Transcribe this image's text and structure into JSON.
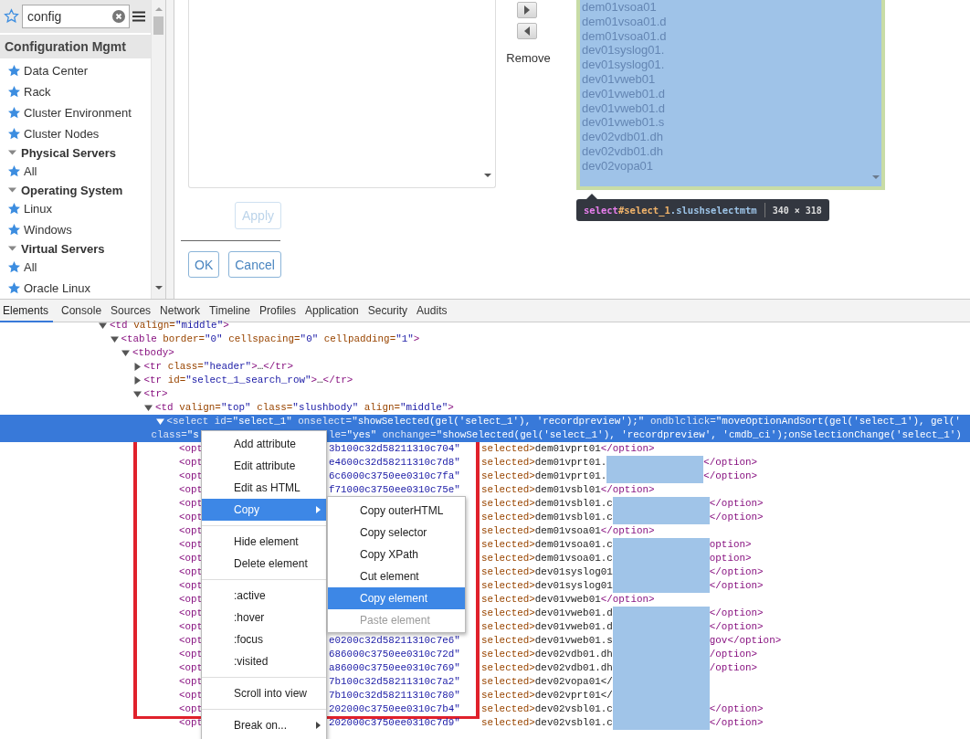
{
  "sidebar": {
    "search": {
      "value": "config"
    },
    "section": "Configuration Mgmt",
    "items": [
      {
        "kind": "item",
        "label": "Data Center"
      },
      {
        "kind": "item",
        "label": "Rack"
      },
      {
        "kind": "item",
        "label": "Cluster Environment"
      },
      {
        "kind": "item",
        "label": "Cluster Nodes"
      },
      {
        "kind": "group",
        "label": "Physical Servers",
        "expanded": true
      },
      {
        "kind": "item",
        "label": "All"
      },
      {
        "kind": "group",
        "label": "Operating System",
        "expanded": true
      },
      {
        "kind": "item",
        "label": "Linux"
      },
      {
        "kind": "item",
        "label": "Windows"
      },
      {
        "kind": "group",
        "label": "Virtual Servers",
        "expanded": true
      },
      {
        "kind": "item",
        "label": "All"
      },
      {
        "kind": "item",
        "label": "Oracle Linux"
      }
    ]
  },
  "form": {
    "apply": {
      "label": "Apply",
      "disabled": true
    },
    "ok": {
      "label": "OK",
      "disabled": false
    },
    "cancel": {
      "label": "Cancel",
      "disabled": false
    },
    "remove_label": "Remove",
    "selected_list": {
      "highlighted": true,
      "items": [
        "dem01vsoa01",
        "dem01vsoa01.d",
        "dem01vsoa01.d",
        "dev01syslog01.",
        "dev01syslog01.",
        "dev01vweb01",
        "dev01vweb01.d",
        "dev01vweb01.d",
        "dev01vweb01.s",
        "dev02vdb01.dh",
        "dev02vdb01.dh",
        "dev02vopa01"
      ]
    },
    "tooltip": {
      "tag": "select",
      "id": "#select_1",
      "class": ".slushselectmtm",
      "size": "340 × 318"
    }
  },
  "devtools": {
    "tabs": [
      {
        "label": "Elements",
        "selected": true
      },
      {
        "label": "Console",
        "selected": false
      },
      {
        "label": "Sources",
        "selected": false
      },
      {
        "label": "Network",
        "selected": false
      },
      {
        "label": "Timeline",
        "selected": false
      },
      {
        "label": "Profiles",
        "selected": false
      },
      {
        "label": "Application",
        "selected": false
      },
      {
        "label": "Security",
        "selected": false
      },
      {
        "label": "Audits",
        "selected": false
      }
    ],
    "tree": {
      "kind": "element",
      "selected": false,
      "expanded": true,
      "tokens": [
        {
          "kind": "tag",
          "text": "<td"
        },
        {
          "kind": "attr",
          "text": " valign="
        },
        {
          "kind": "val",
          "text": "\"middle\""
        },
        {
          "kind": "tag",
          "text": ">"
        }
      ],
      "children": [
        {
          "kind": "element",
          "selected": false,
          "expanded": true,
          "tokens": [
            {
              "kind": "tag",
              "text": "<table"
            },
            {
              "kind": "attr",
              "text": " border="
            },
            {
              "kind": "val",
              "text": "\"0\""
            },
            {
              "kind": "attr",
              "text": " cellspacing="
            },
            {
              "kind": "val",
              "text": "\"0\""
            },
            {
              "kind": "attr",
              "text": " cellpadding="
            },
            {
              "kind": "val",
              "text": "\"1\""
            },
            {
              "kind": "tag",
              "text": ">"
            }
          ],
          "children": [
            {
              "kind": "element",
              "selected": false,
              "expanded": true,
              "tokens": [
                {
                  "kind": "tag",
                  "text": "<tbody>"
                }
              ],
              "children": [
                {
                  "kind": "element",
                  "selected": false,
                  "expanded": false,
                  "tokens": [
                    {
                      "kind": "tag",
                      "text": "<tr"
                    },
                    {
                      "kind": "attr",
                      "text": " class="
                    },
                    {
                      "kind": "val",
                      "text": "\"header\""
                    },
                    {
                      "kind": "tag",
                      "text": ">"
                    },
                    {
                      "kind": "text",
                      "text": "…"
                    },
                    {
                      "kind": "tag",
                      "text": "</tr>"
                    }
                  ]
                },
                {
                  "kind": "element",
                  "selected": false,
                  "expanded": false,
                  "tokens": [
                    {
                      "kind": "tag",
                      "text": "<tr"
                    },
                    {
                      "kind": "attr",
                      "text": " id="
                    },
                    {
                      "kind": "val",
                      "text": "\"select_1_search_row\""
                    },
                    {
                      "kind": "tag",
                      "text": ">"
                    },
                    {
                      "kind": "text",
                      "text": "…"
                    },
                    {
                      "kind": "tag",
                      "text": "</tr>"
                    }
                  ]
                },
                {
                  "kind": "element",
                  "selected": false,
                  "expanded": true,
                  "tokens": [
                    {
                      "kind": "tag",
                      "text": "<tr>"
                    }
                  ],
                  "children": [
                    {
                      "kind": "element",
                      "selected": false,
                      "expanded": true,
                      "tokens": [
                        {
                          "kind": "tag",
                          "text": "<td"
                        },
                        {
                          "kind": "attr",
                          "text": " valign="
                        },
                        {
                          "kind": "val",
                          "text": "\"top\""
                        },
                        {
                          "kind": "attr",
                          "text": " class="
                        },
                        {
                          "kind": "val",
                          "text": "\"slushbody\""
                        },
                        {
                          "kind": "attr",
                          "text": " align="
                        },
                        {
                          "kind": "val",
                          "text": "\"middle\""
                        },
                        {
                          "kind": "tag",
                          "text": ">"
                        }
                      ],
                      "children": [
                        {
                          "kind": "element",
                          "selected": true,
                          "expanded": true,
                          "tokens": [
                            {
                              "kind": "tag",
                              "text": "<select"
                            },
                            {
                              "kind": "attr",
                              "text": " id="
                            },
                            {
                              "kind": "val",
                              "text": "\"select_1\""
                            },
                            {
                              "kind": "attr",
                              "text": " onselect="
                            },
                            {
                              "kind": "val",
                              "text": "\"showSelected(gel('select_1'), 'recordpreview');\""
                            },
                            {
                              "kind": "attr",
                              "text": " ondblclick="
                            },
                            {
                              "kind": "val",
                              "text": "\"moveOptionAndSort(gel('select_1'), gel('"
                            }
                          ],
                          "cont": [
                            {
                              "kind": "attr",
                              "text": "class="
                            },
                            {
                              "kind": "val",
                              "text": "\"s"
                            }
                          ],
                          "cont_after": [
                            {
                              "kind": "attr",
                              "text": "le="
                            },
                            {
                              "kind": "val",
                              "text": "\"yes\""
                            },
                            {
                              "kind": "attr",
                              "text": " onchange="
                            },
                            {
                              "kind": "val",
                              "text": "\"showSelected(gel('select_1'), 'recordpreview', 'cmdb_ci');onSelectionChange('select_1')"
                            }
                          ],
                          "children": [
                            {
                              "kind": "option",
                              "selected": false,
                              "open": "<opt",
                              "hash": "3b100c32d58211310c704\"",
                              "attr": "selected>",
                              "text": "dem01vprt01",
                              "close": "</option>",
                              "redacted": false
                            },
                            {
                              "kind": "option",
                              "selected": false,
                              "open": "<opt",
                              "hash": "e4600c32d58211310c7d8\"",
                              "attr": "selected>",
                              "text": "dem01vprt01.",
                              "close": "</option>",
                              "redacted": true
                            },
                            {
                              "kind": "option",
                              "selected": false,
                              "open": "<opt",
                              "hash": "6c6000c3750ee0310c7fa\"",
                              "attr": "selected>",
                              "text": "dem01vprt01.",
                              "close": "</option>",
                              "redacted": true
                            },
                            {
                              "kind": "option",
                              "selected": false,
                              "open": "<opt",
                              "hash": "f71000c3750ee0310c75e\"",
                              "attr": "selected>",
                              "text": "dem01vsbl01",
                              "close": "</option>",
                              "redacted": false
                            },
                            {
                              "kind": "option",
                              "selected": false,
                              "open": "<opt",
                              "attr": "selected>",
                              "text": "dem01vsbl01.c",
                              "close": "</option>",
                              "redacted": true
                            },
                            {
                              "kind": "option",
                              "selected": false,
                              "open": "<opt",
                              "attr": "selected>",
                              "text": "dem01vsbl01.c",
                              "close": "</option>",
                              "redacted": true
                            },
                            {
                              "kind": "option",
                              "selected": false,
                              "open": "<opt",
                              "attr": "selected>",
                              "text": "dem01vsoa01",
                              "close": "</option>",
                              "redacted": false
                            },
                            {
                              "kind": "option",
                              "selected": false,
                              "open": "<opt",
                              "attr": "selected>",
                              "text": "dem01vsoa01.c",
                              "close": "option>",
                              "redacted": true
                            },
                            {
                              "kind": "option",
                              "selected": false,
                              "open": "<opt",
                              "attr": "selected>",
                              "text": "dem01vsoa01.c",
                              "close": "option>",
                              "redacted": true
                            },
                            {
                              "kind": "option",
                              "selected": false,
                              "open": "<opt",
                              "attr": "selected>",
                              "text": "dev01syslog01",
                              "close": "</option>",
                              "redacted": true
                            },
                            {
                              "kind": "option",
                              "selected": false,
                              "open": "<opt",
                              "attr": "selected>",
                              "text": "dev01syslog01",
                              "close": "</option>",
                              "redacted": true
                            },
                            {
                              "kind": "option",
                              "selected": false,
                              "open": "<opt",
                              "attr": "selected>",
                              "text": "dev01vweb01",
                              "close": "</option>",
                              "redacted": false
                            },
                            {
                              "kind": "option",
                              "selected": false,
                              "open": "<opt",
                              "attr": "selected>",
                              "text": "dev01vweb01.d",
                              "close": "</option>",
                              "redacted": true
                            },
                            {
                              "kind": "option",
                              "selected": false,
                              "open": "<opt",
                              "attr": "selected>",
                              "text": "dev01vweb01.d",
                              "close": "</option>",
                              "redacted": true
                            },
                            {
                              "kind": "option",
                              "selected": false,
                              "open": "<opt",
                              "hash": "e0200c32d58211310c7e6\"",
                              "attr": "selected>",
                              "text": "dev01vweb01.s",
                              "close": "gov</option>",
                              "redacted": true
                            },
                            {
                              "kind": "option",
                              "selected": false,
                              "open": "<opt",
                              "hash": "686000c3750ee0310c72d\"",
                              "attr": "selected>",
                              "text": "dev02vdb01.dh",
                              "close": "/option>",
                              "redacted": true
                            },
                            {
                              "kind": "option",
                              "selected": false,
                              "open": "<opt",
                              "hash": "a86000c3750ee0310c769\"",
                              "attr": "selected>",
                              "text": "dev02vdb01.dh",
                              "close": "/option>",
                              "redacted": true
                            },
                            {
                              "kind": "option",
                              "selected": false,
                              "open": "<opt",
                              "hash": "7b100c32d58211310c7a2\"",
                              "attr": "selected>",
                              "text": "dev02vopa01</",
                              "redacted": true
                            },
                            {
                              "kind": "option",
                              "selected": false,
                              "open": "<opt",
                              "hash": "7b100c32d58211310c780\"",
                              "attr": "selected>",
                              "text": "dev02vprt01</",
                              "redacted": true
                            },
                            {
                              "kind": "option",
                              "selected": false,
                              "open": "<opt",
                              "hash": "202000c3750ee0310c7b4\"",
                              "attr": "selected>",
                              "text": "dev02vsbl01.c",
                              "close": "</option>",
                              "redacted": true
                            },
                            {
                              "kind": "option",
                              "selected": false,
                              "open": "<opt",
                              "hash": "202000c3750ee0310c7d9\"",
                              "attr": "selected>",
                              "text": "dev02vsbl01.c",
                              "close": "</option>",
                              "redacted": true
                            }
                          ]
                        }
                      ]
                    }
                  ]
                }
              ]
            }
          ]
        }
      ]
    },
    "context_menu": {
      "items": [
        {
          "kind": "item",
          "label": "Add attribute",
          "selected": false,
          "submenu": false
        },
        {
          "kind": "item",
          "label": "Edit attribute",
          "selected": false,
          "submenu": false
        },
        {
          "kind": "item",
          "label": "Edit as HTML",
          "selected": false,
          "submenu": false
        },
        {
          "kind": "item",
          "label": "Copy",
          "selected": true,
          "submenu": true
        },
        {
          "kind": "separator"
        },
        {
          "kind": "item",
          "label": "Hide element",
          "selected": false,
          "submenu": false
        },
        {
          "kind": "item",
          "label": "Delete element",
          "selected": false,
          "submenu": false
        },
        {
          "kind": "separator"
        },
        {
          "kind": "item",
          "label": ":active",
          "selected": false,
          "submenu": false
        },
        {
          "kind": "item",
          "label": ":hover",
          "selected": false,
          "submenu": false
        },
        {
          "kind": "item",
          "label": ":focus",
          "selected": false,
          "submenu": false
        },
        {
          "kind": "item",
          "label": ":visited",
          "selected": false,
          "submenu": false
        },
        {
          "kind": "separator"
        },
        {
          "kind": "item",
          "label": "Scroll into view",
          "selected": false,
          "submenu": false
        },
        {
          "kind": "separator"
        },
        {
          "kind": "item",
          "label": "Break on...",
          "selected": false,
          "submenu": true
        }
      ],
      "submenu": [
        {
          "label": "Copy outerHTML",
          "selected": false,
          "disabled": false
        },
        {
          "label": "Copy selector",
          "selected": false,
          "disabled": false
        },
        {
          "label": "Copy XPath",
          "selected": false,
          "disabled": false
        },
        {
          "label": "Cut element",
          "selected": false,
          "disabled": false
        },
        {
          "label": "Copy element",
          "selected": true,
          "disabled": false
        },
        {
          "label": "Paste element",
          "selected": false,
          "disabled": true
        }
      ]
    }
  }
}
